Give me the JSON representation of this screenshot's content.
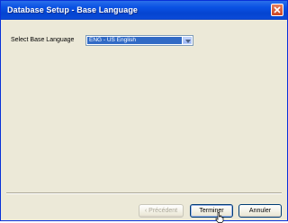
{
  "window": {
    "title": "Database Setup - Base Language"
  },
  "form": {
    "language_label": "Select Base Language",
    "language_value": "ENG - US English"
  },
  "buttons": {
    "previous": "‹ Précédent",
    "finish": "Terminer",
    "cancel": "Annuler"
  },
  "colors": {
    "titlebar": "#0a52e4",
    "selection": "#316ac5",
    "dialog_bg": "#ece9d8"
  },
  "icons": {
    "close": "close-icon",
    "dropdown": "chevron-down-icon",
    "cursor": "hand-cursor-icon"
  }
}
